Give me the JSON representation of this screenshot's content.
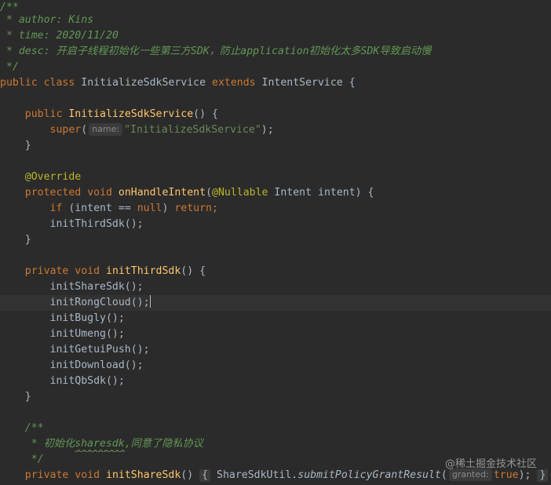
{
  "code": {
    "doc_open": "/**",
    "author": " * author: Kins",
    "time": " * time: 2020/11/20",
    "desc": " * desc: 开启子线程初始化一些第三方SDK，防止application初始化太多SDK导致启动慢",
    "doc_close": " */",
    "kw_public": "public",
    "kw_class": "class",
    "class_name": "InitializeSdkService",
    "kw_extends": "extends",
    "parent_class": "IntentService",
    "open_brace": "{",
    "close_brace": "}",
    "ctor_name": "InitializeSdkService",
    "parens_open": "() {",
    "kw_super": "super",
    "hint_name": "name:",
    "ctor_string": "\"InitializeSdkService\"",
    "stmt_end": ");",
    "annotation_override": "@Override",
    "kw_protected": "protected",
    "kw_void": "void",
    "handle_name": "onHandleIntent",
    "nullable": "@Nullable",
    "handle_params": " Intent intent) {",
    "kw_if": "if",
    "if_cond": " (intent == ",
    "kw_null": "null",
    "kw_return": "return",
    "semicolon": ";",
    "call_init_third": "initThirdSdk();",
    "kw_private": "private",
    "init_third_name": "initThirdSdk",
    "calls": [
      "initShareSdk();",
      "initRongCloud();",
      "initBugly();",
      "initUmeng();",
      "initGetuiPush();",
      "initDownload();",
      "initQbSdk();"
    ],
    "doc2_open": "/**",
    "doc2_prefix": " * 初始化",
    "doc2_word": "sharesdk",
    "doc2_rest": ",同意了隐私协议",
    "doc2_close": " */",
    "init_share_name": "initShareSdk",
    "parens": "()",
    "fold_open": "{",
    "share_util": " ShareSdkUtil.",
    "submit_method": "submitPolicyGrantResult",
    "hint_granted": "granted:",
    "kw_true": "true",
    "fold_close": "}"
  },
  "watermark": "@稀土掘金技术社区",
  "colors": {
    "background": "#2b2b2b",
    "current_line": "#323232",
    "text": "#a9b7c6",
    "keyword": "#cc7832",
    "method": "#ffc66d",
    "string": "#6a8759",
    "comment": "#629755",
    "annotation": "#bbb529"
  }
}
